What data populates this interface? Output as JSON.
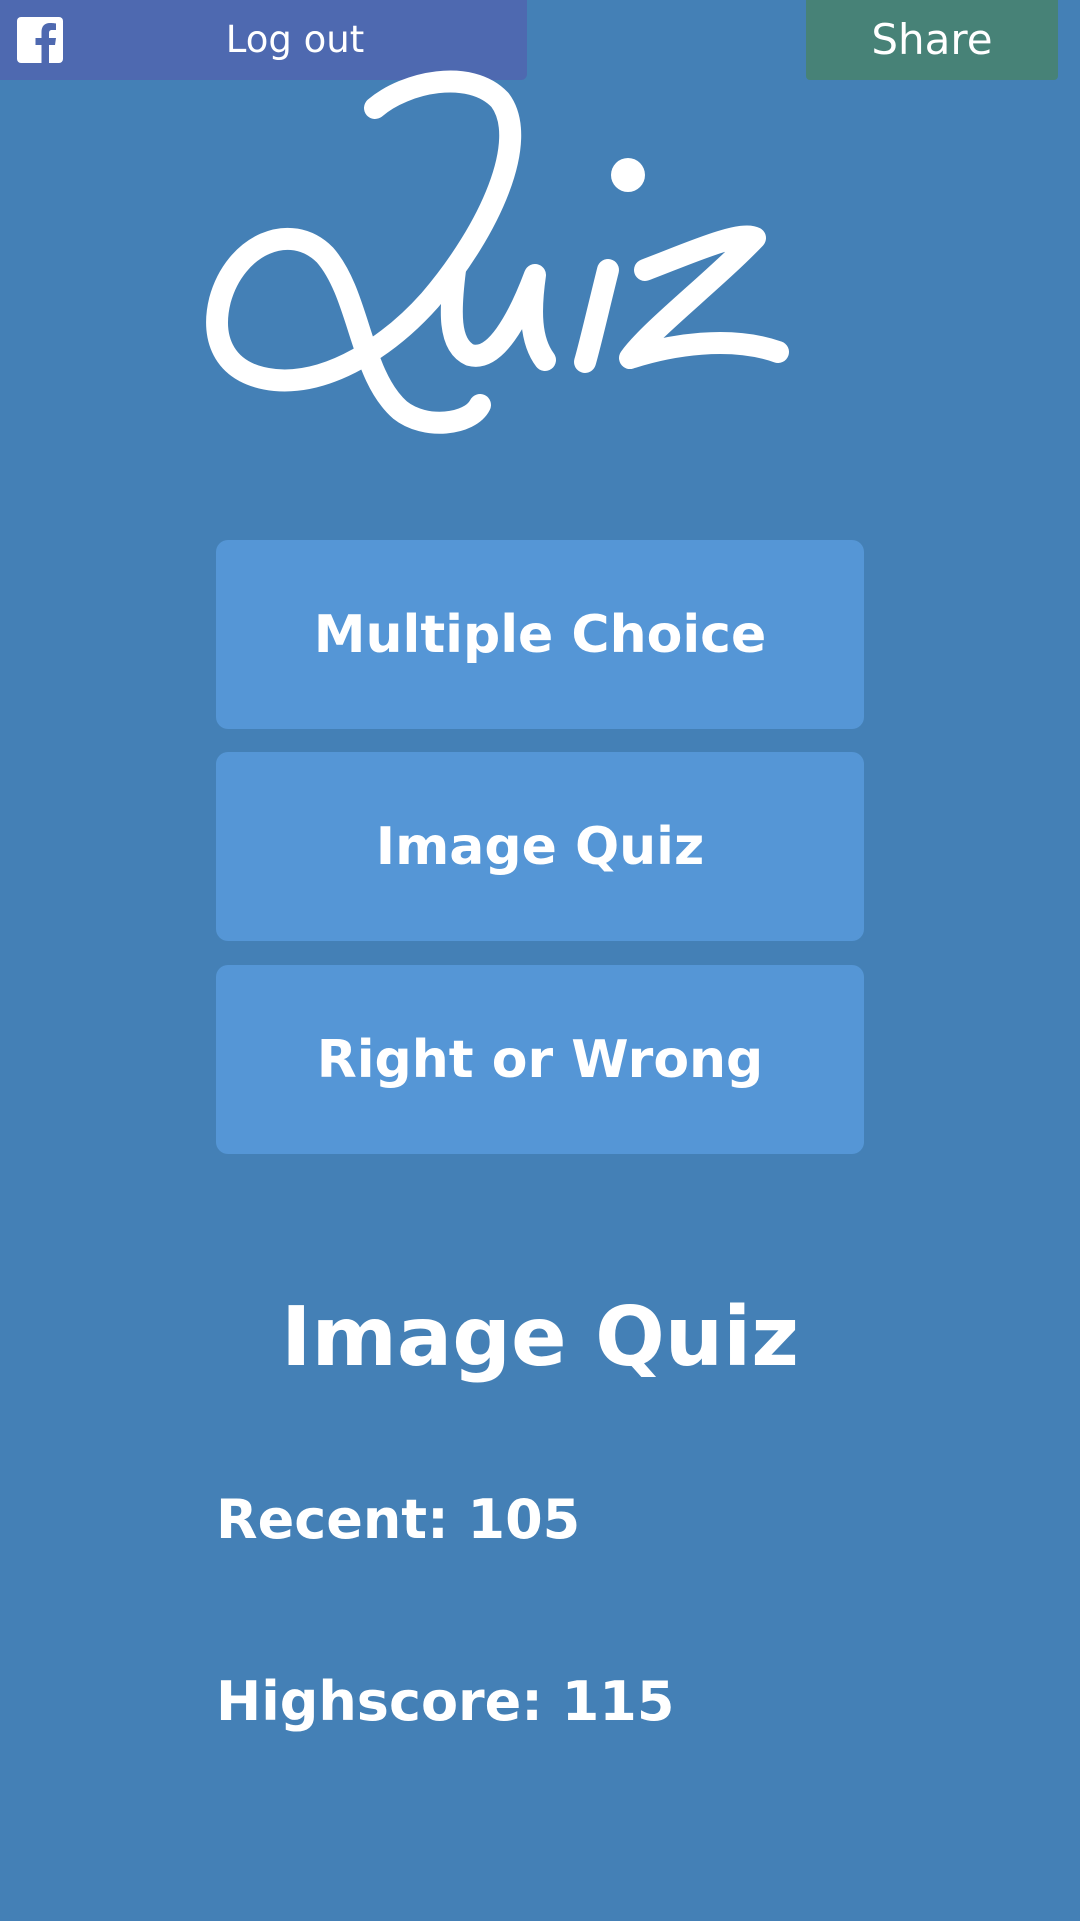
{
  "header": {
    "logout_label": "Log out",
    "share_label": "Share",
    "facebook_color": "#4e69b0",
    "share_color": "#478277"
  },
  "logo": {
    "text": "Quiz"
  },
  "menu": {
    "buttons": [
      {
        "label": "Multiple Choice"
      },
      {
        "label": "Image Quiz"
      },
      {
        "label": "Right or Wrong"
      }
    ],
    "button_color": "#5596d6"
  },
  "stats": {
    "title": "Image Quiz",
    "recent": "Recent: 105",
    "highscore": "Highscore: 115"
  },
  "colors": {
    "background": "#4480b6"
  }
}
